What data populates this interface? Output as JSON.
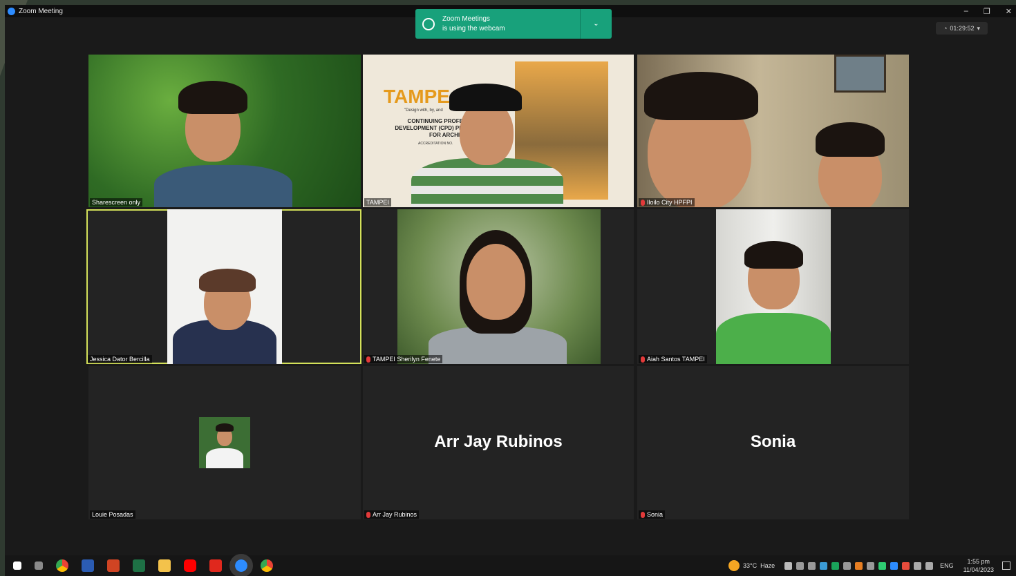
{
  "window": {
    "title": "Zoom Meeting",
    "controls": [
      "–",
      "❐",
      "✕"
    ]
  },
  "notification": {
    "line1": "Zoom Meetings",
    "line2": "is using the webcam",
    "chevron": "⌄"
  },
  "timer": {
    "icon": "shield-icon",
    "value": "01:29:52",
    "dropdown": "▾"
  },
  "tiles": [
    {
      "name": "Sharescreen only",
      "muted": false,
      "video": true
    },
    {
      "name": "TAMPEI",
      "muted": false,
      "video": true
    },
    {
      "name": "Iloilo City HPFPI",
      "muted": true,
      "video": true
    },
    {
      "name": "Jessica Dator Bercilla",
      "muted": false,
      "video": true,
      "active": true
    },
    {
      "name": "TAMPEI Sherilyn Fenete",
      "muted": true,
      "video": true
    },
    {
      "name": "Aiah Santos TAMPEI",
      "muted": true,
      "video": true
    },
    {
      "name": "Louie Posadas",
      "muted": false,
      "video": false
    },
    {
      "name": "Arr Jay Rubinos",
      "muted": true,
      "video": false,
      "display_name": "Arr Jay Rubinos"
    },
    {
      "name": "Sonia",
      "muted": true,
      "video": false,
      "display_name": "Sonia"
    }
  ],
  "slide": {
    "logo": "TAMPE",
    "tagline": "\"Design with, by, and",
    "body": "CONTINUING PROFE DEVELOPMENT (CPD) PR FOR ARCHIT",
    "small": "ACCREDITATION NO."
  },
  "taskbar": {
    "apps": [
      "windows-start-icon",
      "task-view-icon",
      "chrome-icon",
      "word-icon",
      "powerpoint-icon",
      "excel-icon",
      "file-explorer-icon",
      "youtube-icon",
      "acrobat-icon",
      "zoom-icon",
      "chrome-profile-icon"
    ],
    "weather_temp": "33°C",
    "weather_desc": "Haze",
    "language": "ENG",
    "time": "1:55 pm",
    "date": "11/04/2023"
  },
  "colors": {
    "notification_bg": "#18a17b",
    "active_speaker": "#d4e15a",
    "muted_mic": "#e23a3a"
  }
}
